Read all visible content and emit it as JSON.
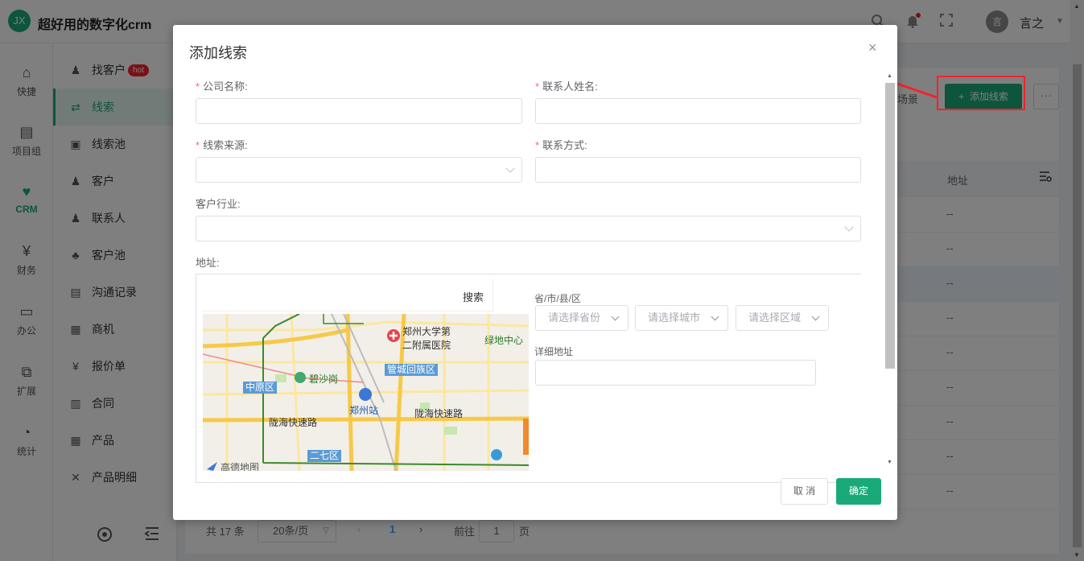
{
  "app": {
    "logo": "JX",
    "title": "超好用的数字化crm"
  },
  "header": {
    "icons": [
      "search-icon",
      "bell-icon",
      "fullscreen-icon"
    ],
    "avatar_text": "言",
    "user_name": "言之"
  },
  "rail": [
    {
      "label": "快捷",
      "icon": "⌂"
    },
    {
      "label": "项目组",
      "icon": "▤"
    },
    {
      "label": "CRM",
      "icon": "♥",
      "active": true
    },
    {
      "label": "财务",
      "icon": "¥"
    },
    {
      "label": "办公",
      "icon": "▭"
    },
    {
      "label": "扩展",
      "icon": "⧉"
    },
    {
      "label": "统计",
      "icon": "◔"
    }
  ],
  "menu": {
    "items": [
      {
        "label": "找客户",
        "icon": "♟",
        "badge": "hot"
      },
      {
        "label": "线索",
        "icon": "⇄",
        "active": true
      },
      {
        "label": "线索池",
        "icon": "▣"
      },
      {
        "label": "客户",
        "icon": "♟"
      },
      {
        "label": "联系人",
        "icon": "♟"
      },
      {
        "label": "客户池",
        "icon": "♣"
      },
      {
        "label": "沟通记录",
        "icon": "▤"
      },
      {
        "label": "商机",
        "icon": "▦"
      },
      {
        "label": "报价单",
        "icon": "¥"
      },
      {
        "label": "合同",
        "icon": "▥"
      },
      {
        "label": "产品",
        "icon": "▦"
      },
      {
        "label": "产品明细",
        "icon": "✕"
      }
    ]
  },
  "toolbar": {
    "scene": "场景",
    "add_label": "添加线索",
    "add_icon": "+",
    "more": "···"
  },
  "table": {
    "col_address": "地址",
    "rows": [
      "--",
      "--",
      "--",
      "--",
      "--",
      "--",
      "--",
      "--",
      "--"
    ]
  },
  "pagination": {
    "total": "共 17 条",
    "page_size": "20条/页",
    "prev": "‹",
    "current": "1",
    "next": "›",
    "goto_prefix": "前往",
    "goto_value": "1",
    "goto_suffix": "页"
  },
  "modal": {
    "title": "添加线索",
    "close": "×",
    "fields": {
      "company": {
        "label": "公司名称:",
        "required": true,
        "value": ""
      },
      "contact_name": {
        "label": "联系人姓名:",
        "required": true,
        "value": ""
      },
      "source": {
        "label": "线索来源:",
        "required": true,
        "value": ""
      },
      "contact_method": {
        "label": "联系方式:",
        "required": true,
        "value": ""
      },
      "industry": {
        "label": "客户行业:",
        "required": false,
        "value": ""
      },
      "address": {
        "label": "地址:"
      }
    },
    "map": {
      "search_label": "搜索",
      "places": {
        "hospital": "郑州大学第\n二附属医院",
        "park": "绿地中心",
        "guancheng": "管城回族区",
        "zhongyuan": "中原区",
        "bishagang": "碧沙岗",
        "station": "郑州站",
        "road_west": "陇海快速路",
        "road_east": "陇海快速路",
        "erqi": "二七区",
        "amap": "高德地图"
      }
    },
    "region": {
      "label": "省/市/县/区",
      "province_placeholder": "请选择省份",
      "city_placeholder": "请选择城市",
      "district_placeholder": "请选择区域",
      "detail_label": "详细地址",
      "detail_value": ""
    },
    "cancel_label": "取 消",
    "ok_label": "确定"
  }
}
